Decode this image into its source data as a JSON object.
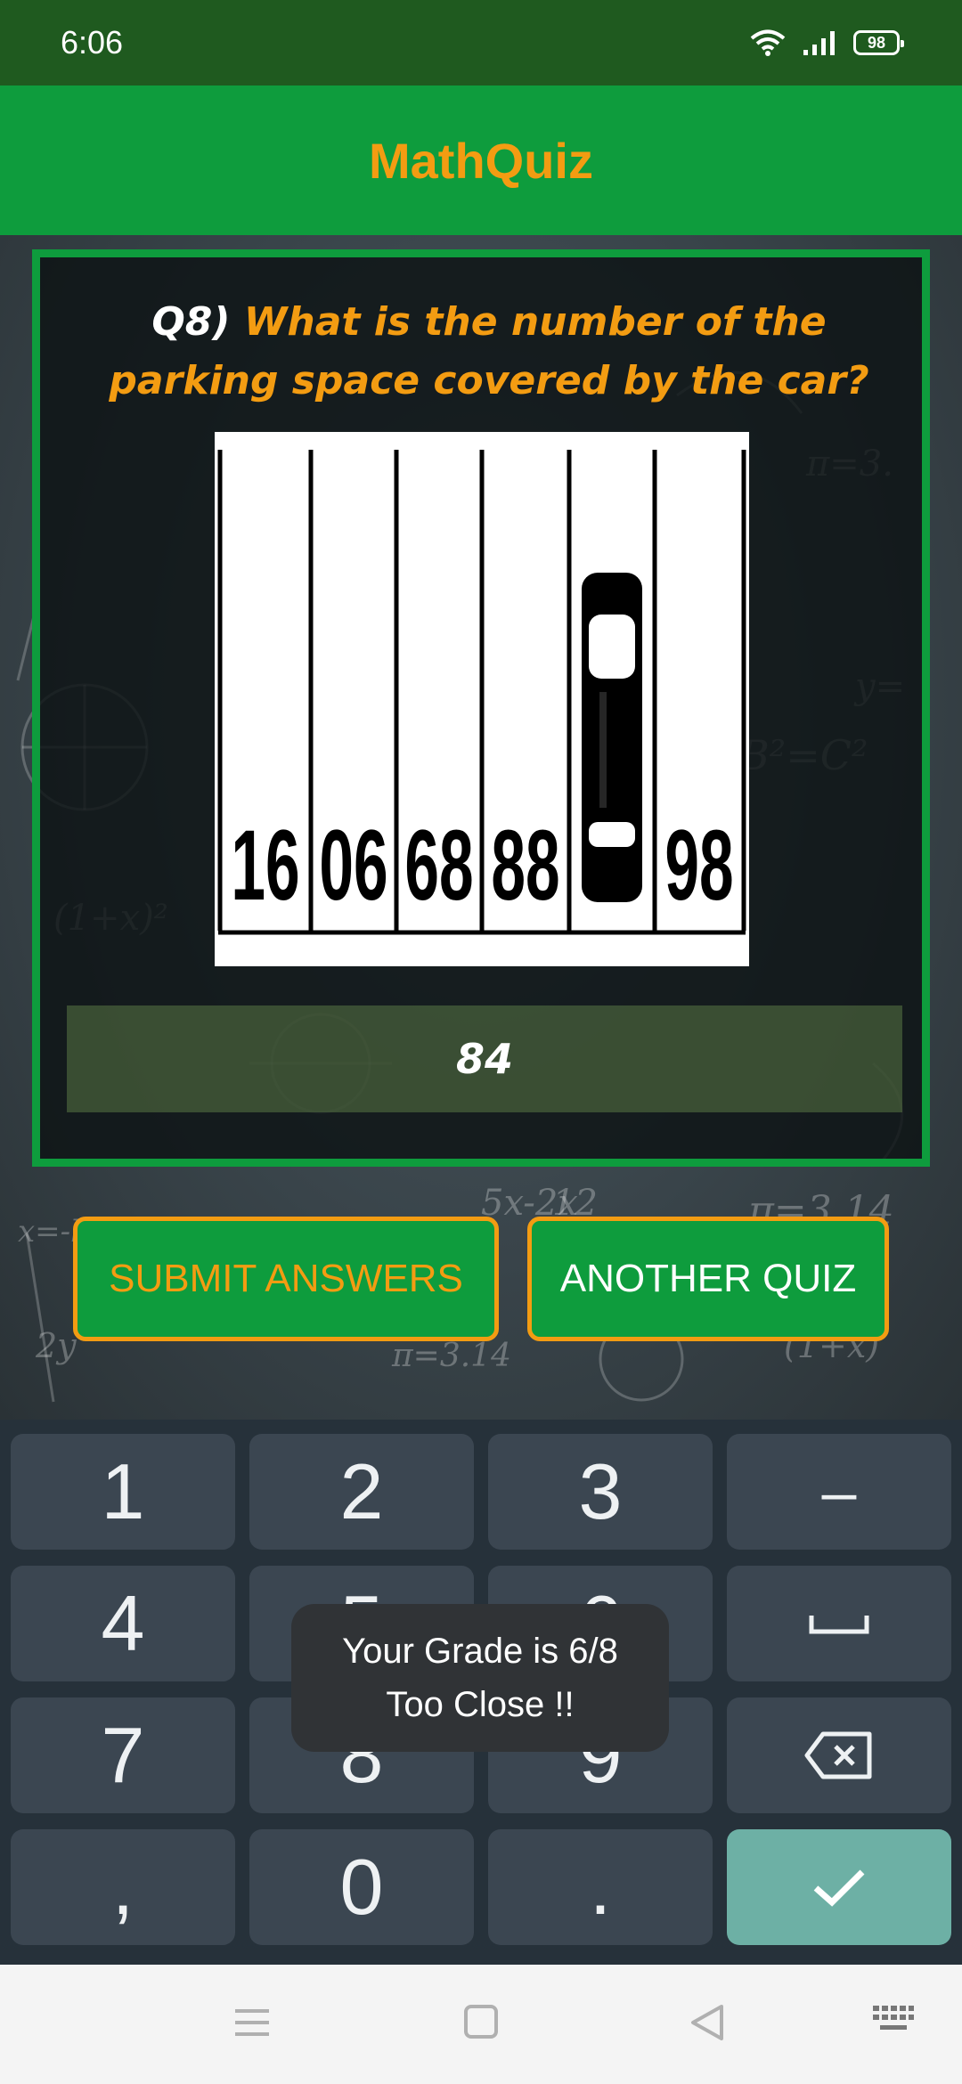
{
  "status_bar": {
    "time": "6:06",
    "battery": "98",
    "icons": [
      "wifi-icon",
      "signal-icon",
      "battery-icon"
    ]
  },
  "app_bar": {
    "title": "MathQuiz"
  },
  "question": {
    "number": "Q8)",
    "text": "What is the number of the parking space covered by the car?",
    "image": {
      "description_icon": "parking-lot-puzzle",
      "space_numbers": [
        "16",
        "06",
        "68",
        "88",
        "",
        "98"
      ]
    }
  },
  "answer": {
    "value": "84"
  },
  "buttons": {
    "submit": "SUBMIT ANSWERS",
    "another": "ANOTHER QUIZ"
  },
  "keyboard": {
    "keys": [
      "1",
      "2",
      "3",
      "–",
      "4",
      "5",
      "6",
      "space",
      "7",
      "8",
      "9",
      "backspace",
      ",",
      "0",
      ".",
      "enter"
    ]
  },
  "toast": {
    "line1": "Your Grade is 6/8",
    "line2": "Too Close !!"
  },
  "colors": {
    "status_bar": "#1f5a1f",
    "app_bar": "#0e9c3d",
    "accent": "#f39c12",
    "keyboard": "#26313a",
    "key": "#3b4651",
    "enter_key": "#6db0a5"
  }
}
